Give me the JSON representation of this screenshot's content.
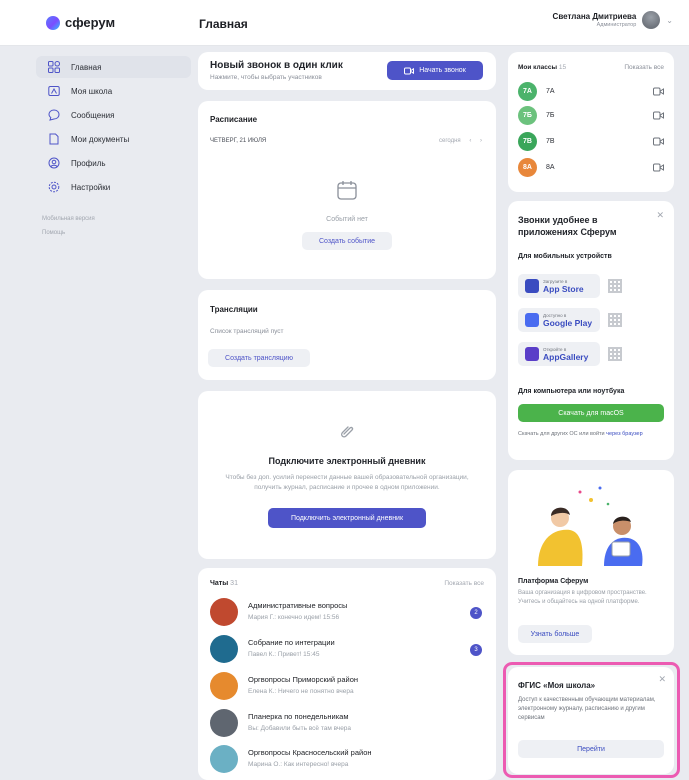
{
  "header": {
    "logo_text": "сферум",
    "page_title": "Главная",
    "user_name": "Светлана Дмитриева",
    "user_role": "Администратор"
  },
  "sidebar": {
    "items": [
      {
        "label": "Главная",
        "icon": "grid-icon",
        "active": true
      },
      {
        "label": "Моя школа",
        "icon": "school-icon",
        "active": false
      },
      {
        "label": "Сообщения",
        "icon": "message-icon",
        "active": false
      },
      {
        "label": "Мои документы",
        "icon": "document-icon",
        "active": false
      },
      {
        "label": "Профиль",
        "icon": "profile-icon",
        "active": false
      },
      {
        "label": "Настройки",
        "icon": "settings-icon",
        "active": false
      }
    ],
    "footer_links": [
      "Мобильная версия",
      "Помощь"
    ]
  },
  "call": {
    "title": "Новый звонок в один клик",
    "subtitle": "Нажмите, чтобы выбрать участников",
    "button": "Начать звонок"
  },
  "schedule": {
    "title": "Расписание",
    "date": "ЧЕТВЕРГ, 21 ИЮЛЯ",
    "today": "сегодня",
    "empty": "Событий нет",
    "button": "Создать событие"
  },
  "broadcasts": {
    "title": "Трансляции",
    "description": "Список трансляций пуст",
    "button": "Создать трансляцию"
  },
  "diary": {
    "title": "Подключите электронный дневник",
    "description": "Чтобы без доп. усилий перенести данные вашей образовательной организации, получить журнал, расписание и прочее в одном приложении.",
    "button": "Подключить электронный дневник"
  },
  "chats": {
    "title": "Чаты",
    "count": "31",
    "show_all": "Показать все",
    "items": [
      {
        "name": "Административные вопросы",
        "message": "Мария Г.: конечно идем!",
        "time": "15:56",
        "unread": "2",
        "color": "#c0492f"
      },
      {
        "name": "Собрание по интеграции",
        "message": "Павел К.: Привет!",
        "time": "15:45",
        "unread": "3",
        "color": "#1f6b8f"
      },
      {
        "name": "Оргвопросы Приморский район",
        "message": "Елена К.: Ничего не понятно",
        "time": "вчера",
        "unread": "",
        "color": "#e68a2e"
      },
      {
        "name": "Планерка по понедельникам",
        "message": "Вы: Добавили быть всё там",
        "time": "вчера",
        "unread": "",
        "color": "#5f6670"
      },
      {
        "name": "Оргвопросы Красносельский район",
        "message": "Марина О.: Как интересно!",
        "time": "вчера",
        "unread": "",
        "color": "#6bb0c4"
      }
    ]
  },
  "classes": {
    "title": "Мои классы",
    "count": "15",
    "show_all": "Показать все",
    "items": [
      {
        "badge": "7А",
        "label": "7А",
        "color": "#4bb36b"
      },
      {
        "badge": "7Б",
        "label": "7Б",
        "color": "#6cc27d"
      },
      {
        "badge": "7В",
        "label": "7В",
        "color": "#3aa65a"
      },
      {
        "badge": "8А",
        "label": "8А",
        "color": "#e8873a"
      }
    ]
  },
  "apps": {
    "title": "Звонки удобнее в приложениях Сферум",
    "mobile": "Для мобильных устройств",
    "stores": [
      {
        "sub": "Загрузите в",
        "name": "App Store",
        "color": "#3a4cc0"
      },
      {
        "sub": "Доступно в",
        "name": "Google Play",
        "color": "#4a6cf0"
      },
      {
        "sub": "Откройте в",
        "name": "AppGallery",
        "color": "#5a3ec8"
      }
    ],
    "laptop": "Для компьютера или ноутбука",
    "download": "Скачать для macOS",
    "other_text": "Скачать для других ОС или войти",
    "other_link": "через браузер"
  },
  "platform": {
    "title": "Платформа Сферум",
    "description": "Ваша организация в цифровом пространстве. Учитесь и общайтесь на одной платформе."
  },
  "learn_more": "Узнать больше",
  "fgis": {
    "title": "ФГИС «Моя школа»",
    "description": "Доступ к качественным обучающим материалам, электронному журналу, расписанию и другим сервисам",
    "button": "Перейти"
  }
}
